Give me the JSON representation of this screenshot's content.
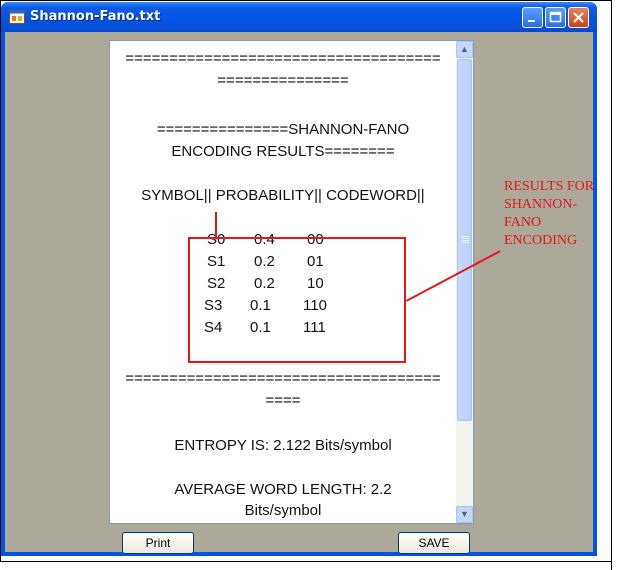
{
  "window": {
    "title": "Shannon-Fano.txt",
    "icon": "app-window-icon"
  },
  "titlebar_buttons": {
    "minimize": "minimize-icon",
    "maximize": "maximize-icon",
    "close": "close-icon"
  },
  "content": {
    "lines": [
      "====================================",
      "===============",
      "===============SHANNON-FANO",
      "ENCODING RESULTS========",
      "SYMBOL||  PROBABILITY|| CODEWORD||"
    ],
    "table": [
      {
        "symbol": "S0",
        "probability": "0.4",
        "codeword": "00"
      },
      {
        "symbol": "S1",
        "probability": "0.2",
        "codeword": "01"
      },
      {
        "symbol": "S2",
        "probability": "0.2",
        "codeword": "10"
      },
      {
        "symbol": "S3",
        "probability": "0.1",
        "codeword": "110"
      },
      {
        "symbol": "S4",
        "probability": "0.1",
        "codeword": "111"
      }
    ],
    "separator_1": "====================================",
    "separator_2": "====",
    "entropy": "ENTROPY IS: 2.122 Bits/symbol",
    "avg_line1": "AVERAGE WORD LENGTH: 2.2",
    "avg_line2": "Bits/symbol"
  },
  "buttons": {
    "print": "Print",
    "save": "SAVE"
  },
  "annotation": {
    "line1": "RESULTS FOR",
    "line2": "SHANNON-FANO",
    "line3": "ENCODING",
    "color": "#e01a1a"
  }
}
